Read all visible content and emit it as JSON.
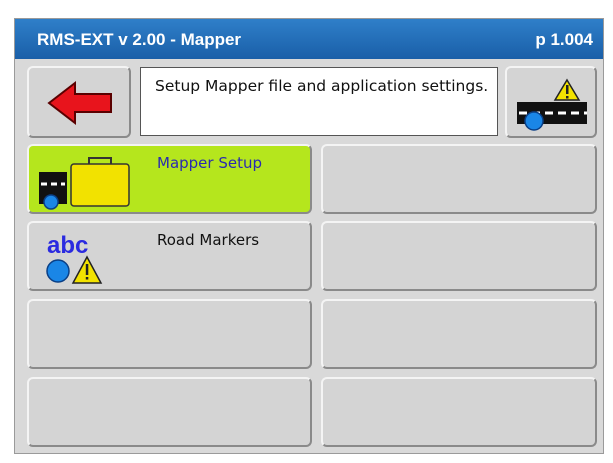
{
  "header": {
    "title": "RMS-EXT v 2.00 - Mapper",
    "page": "p 1.004"
  },
  "description": "Setup Mapper file and application settings.",
  "buttons": {
    "mapper_setup": "Mapper Setup",
    "road_markers": "Road Markers",
    "road_markers_icon_text": "abc"
  },
  "colors": {
    "titlebar": "#1f6bb5",
    "selected_tile": "#b5e61d",
    "back_arrow": "#e8141c"
  },
  "icons": {
    "back": "back-arrow-icon",
    "road_warning": "road-warning-icon",
    "mapper_setup": "truck-briefcase-icon",
    "road_markers": "abc-circle-warning-icon"
  }
}
